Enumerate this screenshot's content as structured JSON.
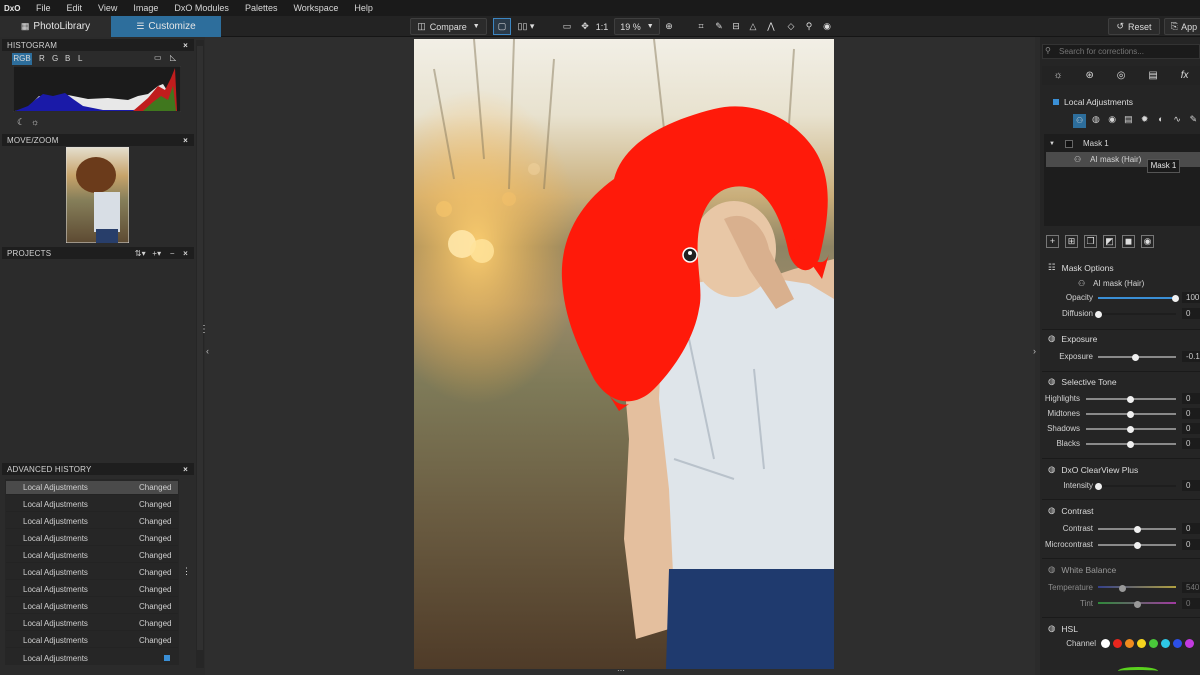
{
  "menu": {
    "logo": "DxO",
    "items": [
      "File",
      "Edit",
      "View",
      "Image",
      "DxO Modules",
      "Palettes",
      "Workspace",
      "Help"
    ]
  },
  "tabs": {
    "photolibrary": "PhotoLibrary",
    "customize": "Customize"
  },
  "toolbar": {
    "compare": "Compare",
    "one_to_one": "1:1",
    "zoom": "19 %",
    "reset": "Reset",
    "app": "App"
  },
  "histogram": {
    "title": "HISTOGRAM",
    "channels": [
      "RGB",
      "R",
      "G",
      "B",
      "L"
    ],
    "selected": "RGB"
  },
  "movezoom": {
    "title": "MOVE/ZOOM"
  },
  "projects": {
    "title": "PROJECTS"
  },
  "history": {
    "title": "ADVANCED HISTORY",
    "rows": [
      {
        "label": "Local Adjustments",
        "status": "Changed"
      },
      {
        "label": "Local Adjustments",
        "status": "Changed"
      },
      {
        "label": "Local Adjustments",
        "status": "Changed"
      },
      {
        "label": "Local Adjustments",
        "status": "Changed"
      },
      {
        "label": "Local Adjustments",
        "status": "Changed"
      },
      {
        "label": "Local Adjustments",
        "status": "Changed"
      },
      {
        "label": "Local Adjustments",
        "status": "Changed"
      },
      {
        "label": "Local Adjustments",
        "status": "Changed"
      },
      {
        "label": "Local Adjustments",
        "status": "Changed"
      },
      {
        "label": "Local Adjustments",
        "status": "Changed"
      },
      {
        "label": "Local Adjustments",
        "status": ""
      }
    ]
  },
  "right": {
    "search_placeholder": "Search for corrections...",
    "local_adjustments": "Local Adjustments",
    "mask1": "Mask 1",
    "ai_mask": "AI mask (Hair)",
    "tooltip": "Mask 1",
    "mask_options": {
      "title": "Mask Options",
      "type": "AI mask (Hair)",
      "opacity_label": "Opacity",
      "opacity_val": "100",
      "diffusion_label": "Diffusion",
      "diffusion_val": "0"
    },
    "exposure": {
      "title": "Exposure",
      "label": "Exposure",
      "val": "-0.1"
    },
    "selective_tone": {
      "title": "Selective Tone",
      "rows": [
        {
          "label": "Highlights",
          "val": "0"
        },
        {
          "label": "Midtones",
          "val": "0"
        },
        {
          "label": "Shadows",
          "val": "0"
        },
        {
          "label": "Blacks",
          "val": "0"
        }
      ]
    },
    "clearview": {
      "title": "DxO ClearView Plus",
      "label": "Intensity",
      "val": "0"
    },
    "contrast": {
      "title": "Contrast",
      "rows": [
        {
          "label": "Contrast",
          "val": "0"
        },
        {
          "label": "Microcontrast",
          "val": "0"
        }
      ]
    },
    "white_balance": {
      "title": "White Balance",
      "temp_label": "Temperature",
      "temp_val": "540",
      "tint_label": "Tint",
      "tint_val": "0"
    },
    "hsl": {
      "title": "HSL",
      "channel_label": "Channel"
    }
  },
  "colors": {
    "accent": "#2d6e9c",
    "mask_red": "#ff1a0a"
  }
}
